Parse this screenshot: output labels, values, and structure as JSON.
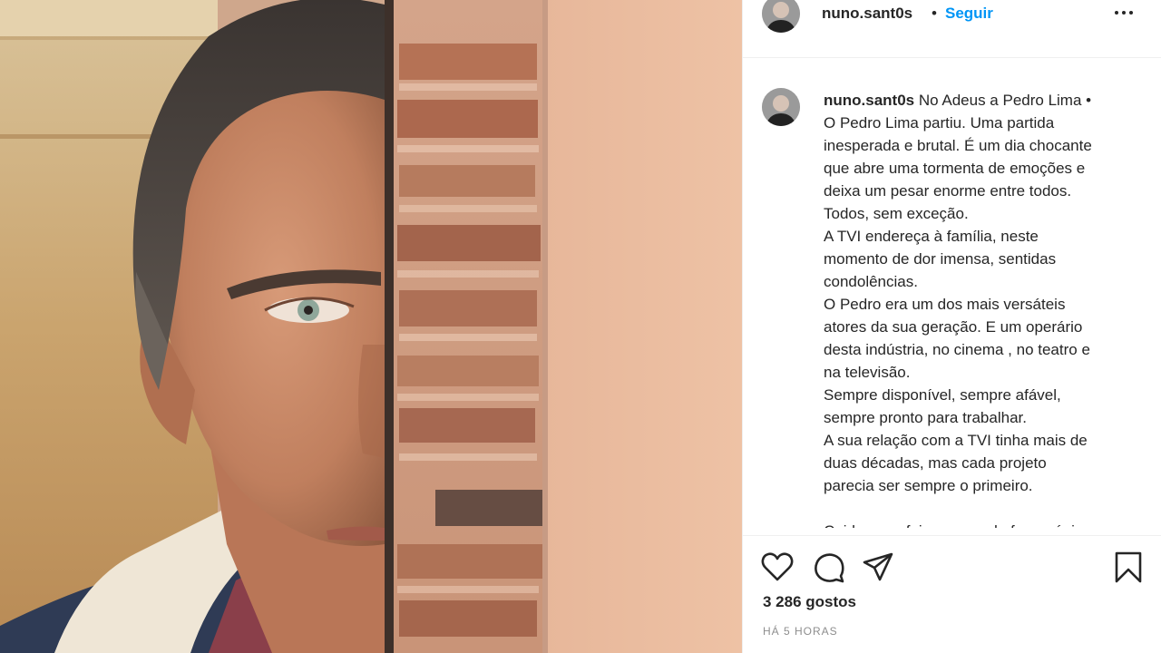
{
  "header": {
    "username": "nuno.sant0s",
    "separator": "•",
    "follow_label": "Seguir"
  },
  "caption": {
    "username": "nuno.sant0s",
    "lines": [
      "No Adeus a Pedro Lima •",
      "O Pedro Lima partiu. Uma partida",
      "inesperada e brutal. É um dia chocante",
      "que abre uma tormenta de emoções e",
      "deixa um pesar enorme entre todos.",
      "Todos, sem exceção.",
      "A TVI endereça à família, neste",
      "momento de dor imensa, sentidas",
      "condolências.",
      "O Pedro era um dos mais versáteis",
      "atores da sua geração. E um operário",
      "desta indústria, no cinema , no teatro e",
      "na televisão.",
      "Sempre disponível, sempre afável,",
      "sempre pronto para trabalhar.",
      "A sua relação com a TVI tinha mais de",
      "duas décadas, mas cada projeto",
      "parecia ser sempre o primeiro.",
      "",
      "Cuidava e afeiçoava-se de forma única"
    ]
  },
  "actions": {
    "like_icon": "heart-icon",
    "comment_icon": "comment-bubble-icon",
    "share_icon": "paper-plane-icon",
    "save_icon": "bookmark-icon"
  },
  "likes": "3 286 gostos",
  "timestamp": "HÁ 5 HORAS",
  "colors": {
    "accent": "#0095f6",
    "text": "#262626",
    "muted": "#8e8e8e",
    "border": "#efefef"
  }
}
